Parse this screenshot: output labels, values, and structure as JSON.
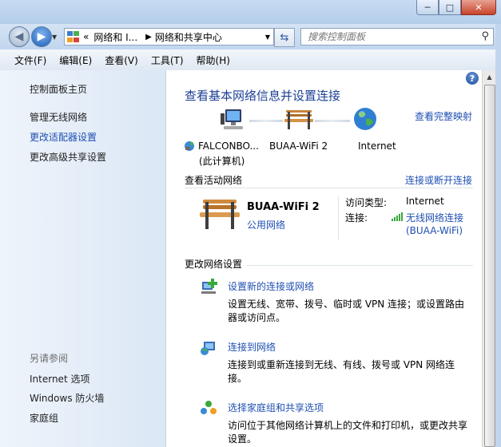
{
  "window": {
    "controls": {
      "minimize": "─",
      "maximize": "□",
      "close": "✕"
    }
  },
  "nav": {
    "back_icon": "back-arrow-icon",
    "forward_icon": "forward-arrow-icon",
    "address": {
      "overflow": "«",
      "segment1": "网络和 I...",
      "segment2": "网络和共享中心"
    },
    "search_placeholder": "搜索控制面板"
  },
  "menu": [
    "文件(F)",
    "编辑(E)",
    "查看(V)",
    "工具(T)",
    "帮助(H)"
  ],
  "sidebar": {
    "home": "控制面板主页",
    "links": [
      "管理无线网络",
      "更改适配器设置",
      "更改高级共享设置"
    ],
    "see_also_heading": "另请参阅",
    "see_also": [
      "Internet 选项",
      "Windows 防火墙",
      "家庭组"
    ]
  },
  "main": {
    "title": "查看基本网络信息并设置连接",
    "full_map_link": "查看完整映射",
    "map": {
      "computer_name": "FALCONBO...",
      "computer_sub": "(此计算机)",
      "network_name": "BUAA-WiFi  2",
      "internet": "Internet"
    },
    "active": {
      "heading": "查看活动网络",
      "connect_link": "连接或断开连接",
      "network_name": "BUAA-WiFi  2",
      "network_type": "公用网络",
      "access_label": "访问类型:",
      "access_value": "Internet",
      "conn_label": "连接:",
      "conn_value1": "无线网络连接",
      "conn_value2": "(BUAA-WiFi)"
    },
    "change": {
      "heading": "更改网络设置",
      "tasks": [
        {
          "title": "设置新的连接或网络",
          "desc1": "设置无线、宽带、拨号、临时或 VPN 连接；或设置路由",
          "desc2": "器或访问点。"
        },
        {
          "title": "连接到网络",
          "desc1": "连接到或重新连接到无线、有线、拨号或 VPN 网络连",
          "desc2": "接。"
        },
        {
          "title": "选择家庭组和共享选项",
          "desc1": "访问位于其他网络计算机上的文件和打印机，或更改共享",
          "desc2": "设置。"
        }
      ]
    }
  },
  "colors": {
    "link": "#1f4fb3",
    "title": "#1c3f94"
  }
}
